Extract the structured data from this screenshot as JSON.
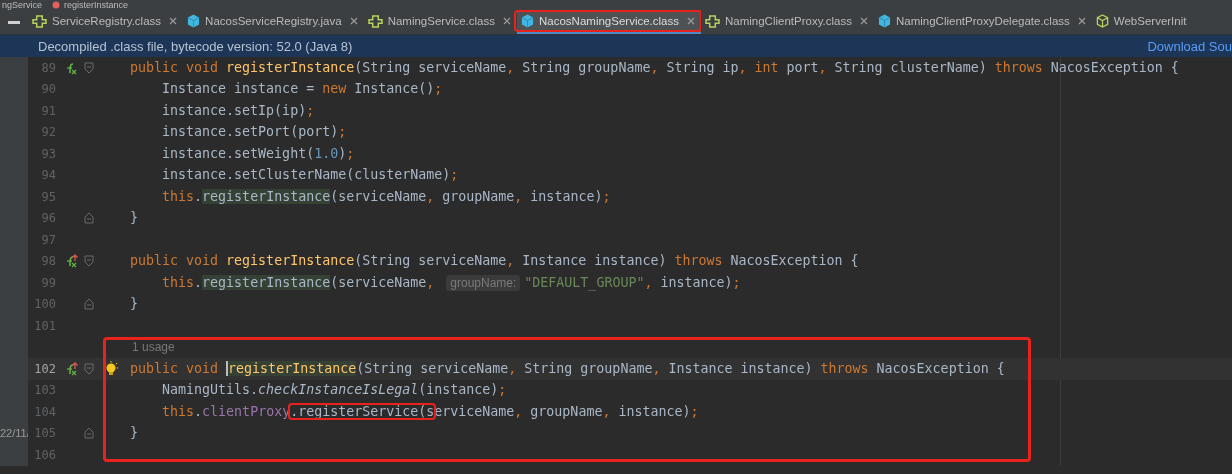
{
  "breadcrumb": [
    {
      "label": "ngService",
      "kind": "file"
    },
    {
      "label": "registerInstance",
      "kind": "method"
    }
  ],
  "tabs": [
    {
      "label": "ServiceRegistry.class",
      "kind": "interface",
      "selected": false,
      "highlighted": false
    },
    {
      "label": "NacosServiceRegistry.java",
      "kind": "class",
      "selected": false,
      "highlighted": false
    },
    {
      "label": "NamingService.class",
      "kind": "interface",
      "selected": false,
      "highlighted": false
    },
    {
      "label": "NacosNamingService.class",
      "kind": "class",
      "selected": true,
      "highlighted": true
    },
    {
      "label": "NamingClientProxy.class",
      "kind": "interface",
      "selected": false,
      "highlighted": false
    },
    {
      "label": "NamingClientProxyDelegate.class",
      "kind": "class",
      "selected": false,
      "highlighted": false
    },
    {
      "label": "WebServerInit",
      "kind": "cube",
      "selected": false,
      "highlighted": false
    }
  ],
  "banner": {
    "message": "Decompiled .class file, bytecode version: 52.0 (Java 8)",
    "link": "Download Sou"
  },
  "rows": [
    {
      "kind": "code",
      "number": "89",
      "marker": true,
      "overrides": false,
      "fold_start": true,
      "fold_end": false,
      "current": false,
      "tokens": [
        {
          "t": "    public void ",
          "kind": "kw"
        },
        {
          "t": "registerInstance",
          "kind": "fn"
        },
        {
          "t": "(String serviceName",
          "kind": "plain"
        },
        {
          "t": ", ",
          "kind": "punct"
        },
        {
          "t": "String groupName",
          "kind": "plain"
        },
        {
          "t": ", ",
          "kind": "punct"
        },
        {
          "t": "String ip",
          "kind": "plain"
        },
        {
          "t": ", ",
          "kind": "punct"
        },
        {
          "t": "int ",
          "kind": "kw"
        },
        {
          "t": "port",
          "kind": "plain"
        },
        {
          "t": ", ",
          "kind": "punct"
        },
        {
          "t": "String clusterName) ",
          "kind": "plain"
        },
        {
          "t": "throws ",
          "kind": "kw"
        },
        {
          "t": "NacosException {",
          "kind": "plain"
        }
      ]
    },
    {
      "kind": "code",
      "number": "90",
      "marker": false,
      "overrides": false,
      "fold_start": false,
      "fold_end": false,
      "current": false,
      "tokens": [
        {
          "t": "        Instance instance = ",
          "kind": "plain"
        },
        {
          "t": "new ",
          "kind": "kw"
        },
        {
          "t": "Instance()",
          "kind": "plain"
        },
        {
          "t": ";",
          "kind": "punct"
        }
      ]
    },
    {
      "kind": "code",
      "number": "91",
      "marker": false,
      "overrides": false,
      "fold_start": false,
      "fold_end": false,
      "current": false,
      "tokens": [
        {
          "t": "        instance.setIp(ip)",
          "kind": "plain"
        },
        {
          "t": ";",
          "kind": "punct"
        }
      ]
    },
    {
      "kind": "code",
      "number": "92",
      "marker": false,
      "overrides": false,
      "fold_start": false,
      "fold_end": false,
      "current": false,
      "tokens": [
        {
          "t": "        instance.setPort(port)",
          "kind": "plain"
        },
        {
          "t": ";",
          "kind": "punct"
        }
      ]
    },
    {
      "kind": "code",
      "number": "93",
      "marker": false,
      "overrides": false,
      "fold_start": false,
      "fold_end": false,
      "current": false,
      "tokens": [
        {
          "t": "        instance.setWeight(",
          "kind": "plain"
        },
        {
          "t": "1.0",
          "kind": "num"
        },
        {
          "t": ")",
          "kind": "plain"
        },
        {
          "t": ";",
          "kind": "punct"
        }
      ]
    },
    {
      "kind": "code",
      "number": "94",
      "marker": false,
      "overrides": false,
      "fold_start": false,
      "fold_end": false,
      "current": false,
      "tokens": [
        {
          "t": "        instance.setClusterName(clusterName)",
          "kind": "plain"
        },
        {
          "t": ";",
          "kind": "punct"
        }
      ]
    },
    {
      "kind": "code",
      "number": "95",
      "marker": false,
      "overrides": false,
      "fold_start": false,
      "fold_end": false,
      "current": false,
      "tokens": [
        {
          "t": "        this",
          "kind": "kw"
        },
        {
          "t": ".",
          "kind": "plain"
        },
        {
          "t": "registerInstance",
          "kind": "usage"
        },
        {
          "t": "(serviceName",
          "kind": "plain"
        },
        {
          "t": ", ",
          "kind": "punct"
        },
        {
          "t": "groupName",
          "kind": "plain"
        },
        {
          "t": ", ",
          "kind": "punct"
        },
        {
          "t": "instance)",
          "kind": "plain"
        },
        {
          "t": ";",
          "kind": "punct"
        }
      ]
    },
    {
      "kind": "code",
      "number": "96",
      "marker": false,
      "overrides": false,
      "fold_start": false,
      "fold_end": true,
      "current": false,
      "tokens": [
        {
          "t": "    }",
          "kind": "plain"
        }
      ]
    },
    {
      "kind": "code",
      "number": "97",
      "marker": false,
      "overrides": false,
      "fold_start": false,
      "fold_end": false,
      "current": false,
      "tokens": []
    },
    {
      "kind": "code",
      "number": "98",
      "marker": true,
      "overrides": true,
      "fold_start": true,
      "fold_end": false,
      "current": false,
      "tokens": [
        {
          "t": "    public void ",
          "kind": "kw"
        },
        {
          "t": "registerInstance",
          "kind": "fn"
        },
        {
          "t": "(String serviceName",
          "kind": "plain"
        },
        {
          "t": ", ",
          "kind": "punct"
        },
        {
          "t": "Instance instance) ",
          "kind": "plain"
        },
        {
          "t": "throws ",
          "kind": "kw"
        },
        {
          "t": "NacosException {",
          "kind": "plain"
        }
      ]
    },
    {
      "kind": "code",
      "number": "99",
      "marker": false,
      "overrides": false,
      "fold_start": false,
      "fold_end": false,
      "current": false,
      "tokens": [
        {
          "t": "        this",
          "kind": "kw"
        },
        {
          "t": ".",
          "kind": "plain"
        },
        {
          "t": "registerInstance",
          "kind": "usage"
        },
        {
          "t": "(serviceName",
          "kind": "plain"
        },
        {
          "t": ", ",
          "kind": "punct"
        },
        {
          "t": "groupName:",
          "kind": "hint"
        },
        {
          "t": "\"DEFAULT_GROUP\"",
          "kind": "str"
        },
        {
          "t": ", ",
          "kind": "punct"
        },
        {
          "t": "instance)",
          "kind": "plain"
        },
        {
          "t": ";",
          "kind": "punct"
        }
      ]
    },
    {
      "kind": "code",
      "number": "100",
      "marker": false,
      "overrides": false,
      "fold_start": false,
      "fold_end": true,
      "current": false,
      "tokens": [
        {
          "t": "    }",
          "kind": "plain"
        }
      ]
    },
    {
      "kind": "code",
      "number": "101",
      "marker": false,
      "overrides": false,
      "fold_start": false,
      "fold_end": false,
      "current": false,
      "tokens": []
    }
  ],
  "framed_rows": [
    {
      "kind": "usage",
      "text": "1 usage"
    },
    {
      "kind": "code",
      "number": "102",
      "marker": true,
      "overrides": true,
      "fold_start": true,
      "fold_end": false,
      "current": true,
      "bulb": true,
      "tokens": [
        {
          "t": "    public void ",
          "kind": "kw"
        },
        {
          "t": "registerInstance",
          "kind": "fn-usage",
          "caret": true
        },
        {
          "t": "(String serviceName",
          "kind": "plain"
        },
        {
          "t": ", ",
          "kind": "punct"
        },
        {
          "t": "String groupName",
          "kind": "plain"
        },
        {
          "t": ", ",
          "kind": "punct"
        },
        {
          "t": "Instance instance) ",
          "kind": "plain"
        },
        {
          "t": "throws ",
          "kind": "kw"
        },
        {
          "t": "NacosException {",
          "kind": "plain"
        }
      ]
    },
    {
      "kind": "code",
      "number": "103",
      "marker": false,
      "overrides": false,
      "fold_start": false,
      "fold_end": false,
      "current": false,
      "tokens": [
        {
          "t": "        NamingUtils.",
          "kind": "plain"
        },
        {
          "t": "checkInstanceIsLegal",
          "kind": "italic"
        },
        {
          "t": "(instance)",
          "kind": "plain"
        },
        {
          "t": ";",
          "kind": "punct"
        }
      ]
    },
    {
      "kind": "code",
      "number": "104",
      "marker": false,
      "overrides": false,
      "fold_start": false,
      "fold_end": false,
      "current": false,
      "tokens": [
        {
          "t": "        this",
          "kind": "kw"
        },
        {
          "t": ".",
          "kind": "plain"
        },
        {
          "t": "clientProxy",
          "kind": "field"
        },
        {
          "t": ".registerService(s",
          "kind": "plain",
          "boxed": true
        },
        {
          "t": "erviceName",
          "kind": "plain"
        },
        {
          "t": ", ",
          "kind": "punct"
        },
        {
          "t": "groupName",
          "kind": "plain"
        },
        {
          "t": ", ",
          "kind": "punct"
        },
        {
          "t": "instance)",
          "kind": "plain"
        },
        {
          "t": ";",
          "kind": "punct"
        }
      ]
    },
    {
      "kind": "code",
      "number": "105",
      "marker": false,
      "overrides": false,
      "fold_start": false,
      "fold_end": true,
      "current": false,
      "side_text": "22/11/",
      "tokens": [
        {
          "t": "    }",
          "kind": "plain"
        }
      ]
    },
    {
      "kind": "code",
      "number": "106",
      "marker": false,
      "overrides": false,
      "fold_start": false,
      "fold_end": false,
      "current": false,
      "tokens": []
    }
  ]
}
